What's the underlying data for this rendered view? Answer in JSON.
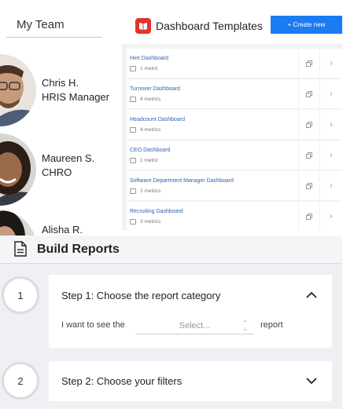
{
  "team": {
    "title": "My Team",
    "members": [
      {
        "name": "Chris H.",
        "role": "HRIS Manager"
      },
      {
        "name": "Maureen S.",
        "role": "CHRO"
      },
      {
        "name": "Alisha R.",
        "role": ""
      }
    ]
  },
  "dashboard_templates": {
    "title": "Dashboard Templates",
    "logo_icon": "book-icon",
    "create_button": "+ Create new",
    "items": [
      {
        "name": "Hire Dashboard",
        "metrics": "1 metric"
      },
      {
        "name": "Turnover Dashboard",
        "metrics": "4 metrics"
      },
      {
        "name": "Headcount Dashboard",
        "metrics": "4 metrics"
      },
      {
        "name": "CEO Dashboard",
        "metrics": "1 metric"
      },
      {
        "name": "Software Department Manager Dashboard",
        "metrics": "2 metrics"
      },
      {
        "name": "Recruiting Dashboard",
        "metrics": "3 metrics"
      }
    ]
  },
  "build_reports": {
    "title": "Build Reports",
    "steps": [
      {
        "number": "1",
        "title": "Step 1: Choose the report category",
        "expanded": true,
        "query_prefix": "I want to see the",
        "select_placeholder": "Select...",
        "query_suffix": "report"
      },
      {
        "number": "2",
        "title": "Step 2: Choose your filters",
        "expanded": false
      }
    ]
  },
  "colors": {
    "accent": "#1a7bf2",
    "logo": "#e4332f",
    "link": "#2f63b5",
    "panel_bg": "#eef0f3"
  }
}
